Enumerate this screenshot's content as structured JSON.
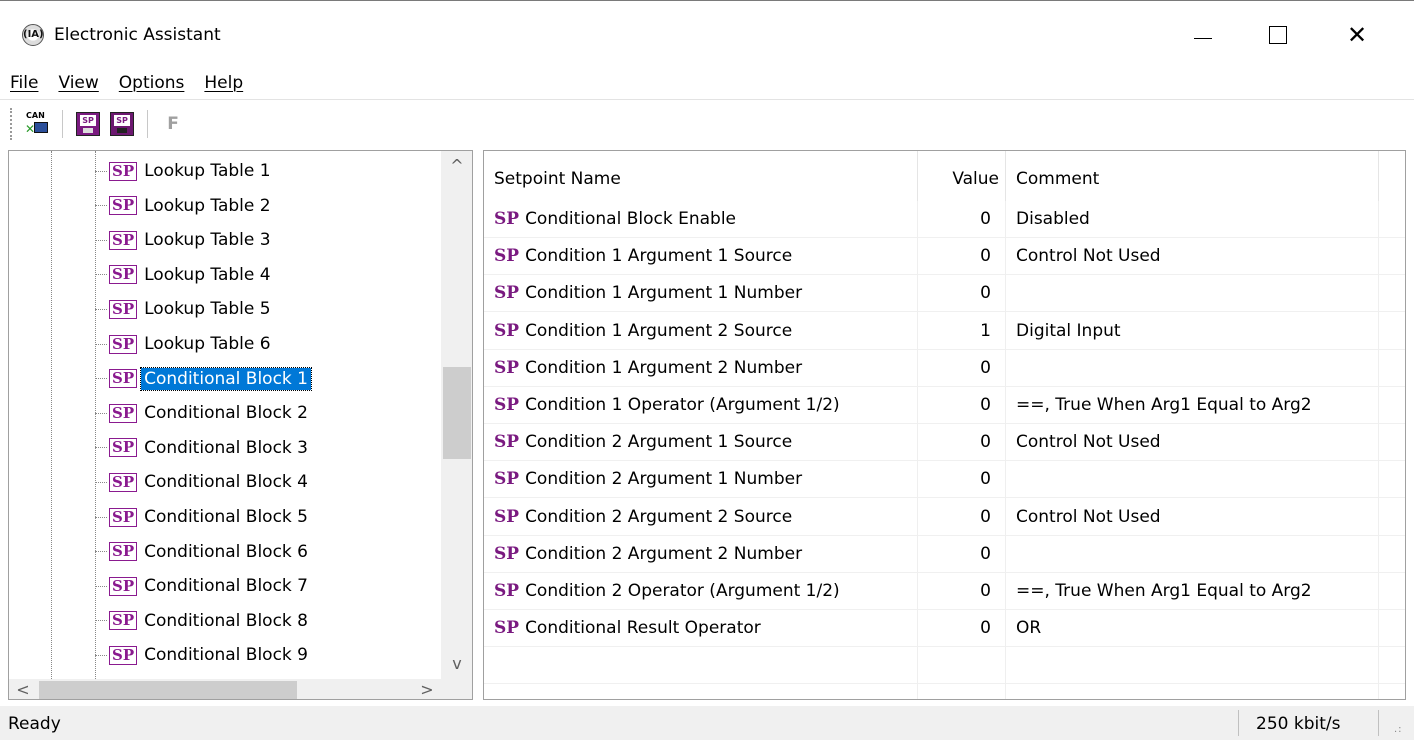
{
  "window": {
    "title": "Electronic Assistant",
    "icon_glyph": "(IA)",
    "minimize_glyph": "",
    "close_glyph": "✕"
  },
  "menu": [
    "File",
    "View",
    "Options",
    "Help"
  ],
  "toolbar": {
    "can_label": "CAN",
    "sp_label": "SP",
    "f_label": "F"
  },
  "tree": {
    "badge": "SP",
    "items": [
      {
        "label": "Lookup Table 1"
      },
      {
        "label": "Lookup Table 2"
      },
      {
        "label": "Lookup Table 3"
      },
      {
        "label": "Lookup Table 4"
      },
      {
        "label": "Lookup Table 5"
      },
      {
        "label": "Lookup Table 6"
      },
      {
        "label": "Conditional Block 1",
        "selected": true
      },
      {
        "label": "Conditional Block 2"
      },
      {
        "label": "Conditional Block 3"
      },
      {
        "label": "Conditional Block 4"
      },
      {
        "label": "Conditional Block 5"
      },
      {
        "label": "Conditional Block 6"
      },
      {
        "label": "Conditional Block 7"
      },
      {
        "label": "Conditional Block 8"
      },
      {
        "label": "Conditional Block 9"
      }
    ],
    "scroll_up": "^",
    "scroll_down": "v",
    "scroll_left": "<",
    "scroll_right": ">"
  },
  "table": {
    "columns": [
      "Setpoint Name",
      "Value",
      "Comment"
    ],
    "sp_prefix": "SP",
    "rows": [
      {
        "name": "Conditional Block Enable",
        "value": "0",
        "comment": "Disabled"
      },
      {
        "name": "Condition 1 Argument 1 Source",
        "value": "0",
        "comment": "Control Not Used"
      },
      {
        "name": "Condition 1 Argument 1 Number",
        "value": "0",
        "comment": ""
      },
      {
        "name": "Condition 1 Argument 2 Source",
        "value": "1",
        "comment": "Digital Input"
      },
      {
        "name": "Condition 1 Argument 2 Number",
        "value": "0",
        "comment": ""
      },
      {
        "name": "Condition 1 Operator (Argument 1/2)",
        "value": "0",
        "comment": "==, True When Arg1 Equal to Arg2"
      },
      {
        "name": "Condition 2 Argument 1 Source",
        "value": "0",
        "comment": "Control Not Used"
      },
      {
        "name": "Condition 2 Argument 1 Number",
        "value": "0",
        "comment": ""
      },
      {
        "name": "Condition 2 Argument 2 Source",
        "value": "0",
        "comment": "Control Not Used"
      },
      {
        "name": "Condition 2 Argument 2 Number",
        "value": "0",
        "comment": ""
      },
      {
        "name": "Condition 2 Operator (Argument 1/2)",
        "value": "0",
        "comment": "==, True When Arg1 Equal to Arg2"
      },
      {
        "name": "Conditional Result Operator",
        "value": "0",
        "comment": "OR"
      }
    ]
  },
  "status": {
    "left": "Ready",
    "right": "250 kbit/s"
  },
  "colors": {
    "sp_purple": "#7a1a80",
    "selection": "#0078d7"
  }
}
